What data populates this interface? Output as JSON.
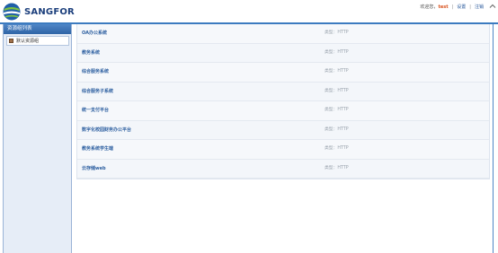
{
  "header": {
    "logo_text": "SANGFOR",
    "welcome": "欢迎您，",
    "username": "test",
    "settings_link": "设置",
    "logout_link": "注销"
  },
  "sidebar": {
    "title": "资源组列表",
    "groups": [
      {
        "label": "默认资源组"
      }
    ]
  },
  "resources": [
    {
      "name": "OA办公系统",
      "type": "类型：HTTP"
    },
    {
      "name": "教务系统",
      "type": "类型：HTTP"
    },
    {
      "name": "综合服务系统",
      "type": "类型：HTTP"
    },
    {
      "name": "综合服务子系统",
      "type": "类型：HTTP"
    },
    {
      "name": "统一支付平台",
      "type": "类型：HTTP"
    },
    {
      "name": "数字化校园财务办公平台",
      "type": "类型：HTTP"
    },
    {
      "name": "教务系统学生端",
      "type": "类型：HTTP"
    },
    {
      "name": "云存储web",
      "type": "类型：HTTP"
    }
  ],
  "colors": {
    "accent": "#3c7bc0",
    "link": "#2d5fa0",
    "username": "#d9531e"
  }
}
